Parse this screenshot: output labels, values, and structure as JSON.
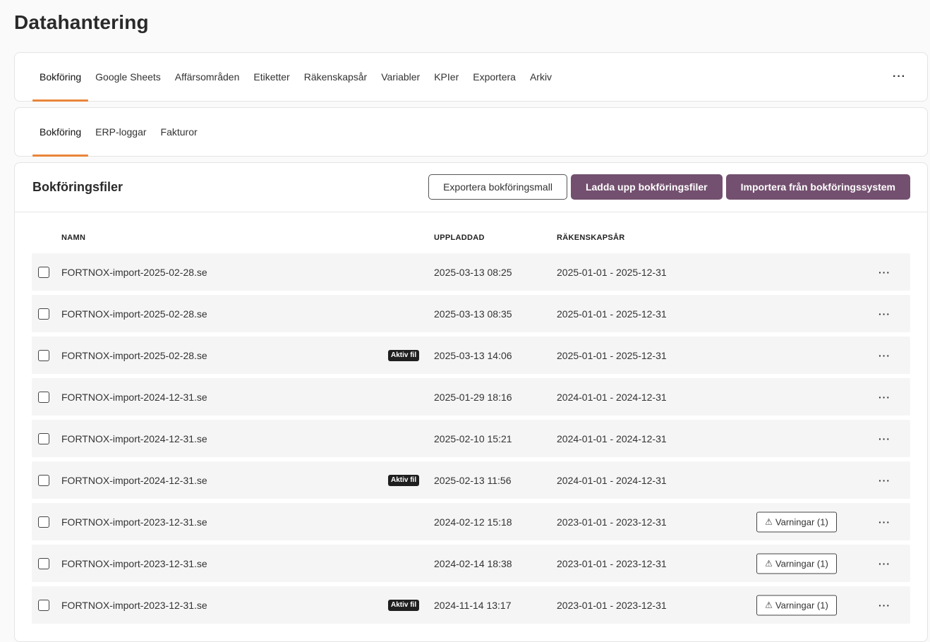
{
  "page": {
    "title": "Datahantering"
  },
  "main_tabs": [
    {
      "label": "Bokföring",
      "active": true
    },
    {
      "label": "Google Sheets"
    },
    {
      "label": "Affärsområden"
    },
    {
      "label": "Etiketter"
    },
    {
      "label": "Räkenskapsår"
    },
    {
      "label": "Variabler"
    },
    {
      "label": "KPIer"
    },
    {
      "label": "Exportera"
    },
    {
      "label": "Arkiv"
    }
  ],
  "main_more": "···",
  "sub_tabs": [
    {
      "label": "Bokföring",
      "active": true
    },
    {
      "label": "ERP-loggar"
    },
    {
      "label": "Fakturor"
    }
  ],
  "files": {
    "title": "Bokföringsfiler",
    "export_template": "Exportera bokföringsmall",
    "upload": "Ladda upp bokföringsfiler",
    "import": "Importera från bokföringssystem",
    "columns": {
      "name": "NAMN",
      "uploaded": "UPPLADDAD",
      "fiscal_year": "RÄKENSKAPSÅR"
    },
    "badge_label": "Aktiv fil",
    "warning_label": "Varningar (1)",
    "row_more": "···",
    "rows": [
      {
        "name": "FORTNOX-import-2025-02-28.se",
        "uploaded": "2025-03-13 08:25",
        "fiscal_year": "2025-01-01 - 2025-12-31",
        "active": false,
        "warning": false
      },
      {
        "name": "FORTNOX-import-2025-02-28.se",
        "uploaded": "2025-03-13 08:35",
        "fiscal_year": "2025-01-01 - 2025-12-31",
        "active": false,
        "warning": false
      },
      {
        "name": "FORTNOX-import-2025-02-28.se",
        "uploaded": "2025-03-13 14:06",
        "fiscal_year": "2025-01-01 - 2025-12-31",
        "active": true,
        "warning": false
      },
      {
        "name": "FORTNOX-import-2024-12-31.se",
        "uploaded": "2025-01-29 18:16",
        "fiscal_year": "2024-01-01 - 2024-12-31",
        "active": false,
        "warning": false
      },
      {
        "name": "FORTNOX-import-2024-12-31.se",
        "uploaded": "2025-02-10 15:21",
        "fiscal_year": "2024-01-01 - 2024-12-31",
        "active": false,
        "warning": false
      },
      {
        "name": "FORTNOX-import-2024-12-31.se",
        "uploaded": "2025-02-13 11:56",
        "fiscal_year": "2024-01-01 - 2024-12-31",
        "active": true,
        "warning": false
      },
      {
        "name": "FORTNOX-import-2023-12-31.se",
        "uploaded": "2024-02-12 15:18",
        "fiscal_year": "2023-01-01 - 2023-12-31",
        "active": false,
        "warning": true
      },
      {
        "name": "FORTNOX-import-2023-12-31.se",
        "uploaded": "2024-02-14 18:38",
        "fiscal_year": "2023-01-01 - 2023-12-31",
        "active": false,
        "warning": true
      },
      {
        "name": "FORTNOX-import-2023-12-31.se",
        "uploaded": "2024-11-14 13:17",
        "fiscal_year": "2023-01-01 - 2023-12-31",
        "active": true,
        "warning": true
      }
    ]
  },
  "colors": {
    "accent": "#e9853a",
    "primary": "#73506f"
  }
}
